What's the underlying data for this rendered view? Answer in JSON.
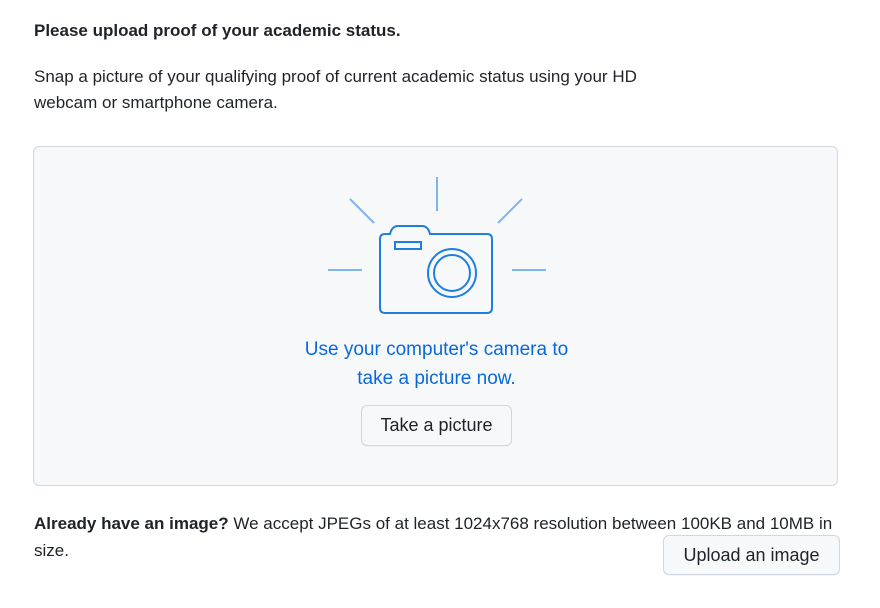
{
  "heading": "Please upload proof of your academic status.",
  "description": "Snap a picture of your qualifying proof of current academic status using your HD webcam or smartphone camera.",
  "camera_panel": {
    "icon": "camera-icon",
    "line1": "Use your computer's camera to",
    "line2": "take a picture now.",
    "take_picture_label": "Take a picture"
  },
  "footer": {
    "prefix": "Already have an image?",
    "text": " We accept JPEGs of at least 1024x768 resolution between 100KB and 10MB in size.",
    "upload_label": "Upload an image"
  },
  "colors": {
    "accent": "#0969da",
    "icon_stroke": "#1f7fe0",
    "ray_stroke": "#7fb5ee",
    "panel_bg": "#f6f8fa",
    "border": "#d0d7de"
  }
}
